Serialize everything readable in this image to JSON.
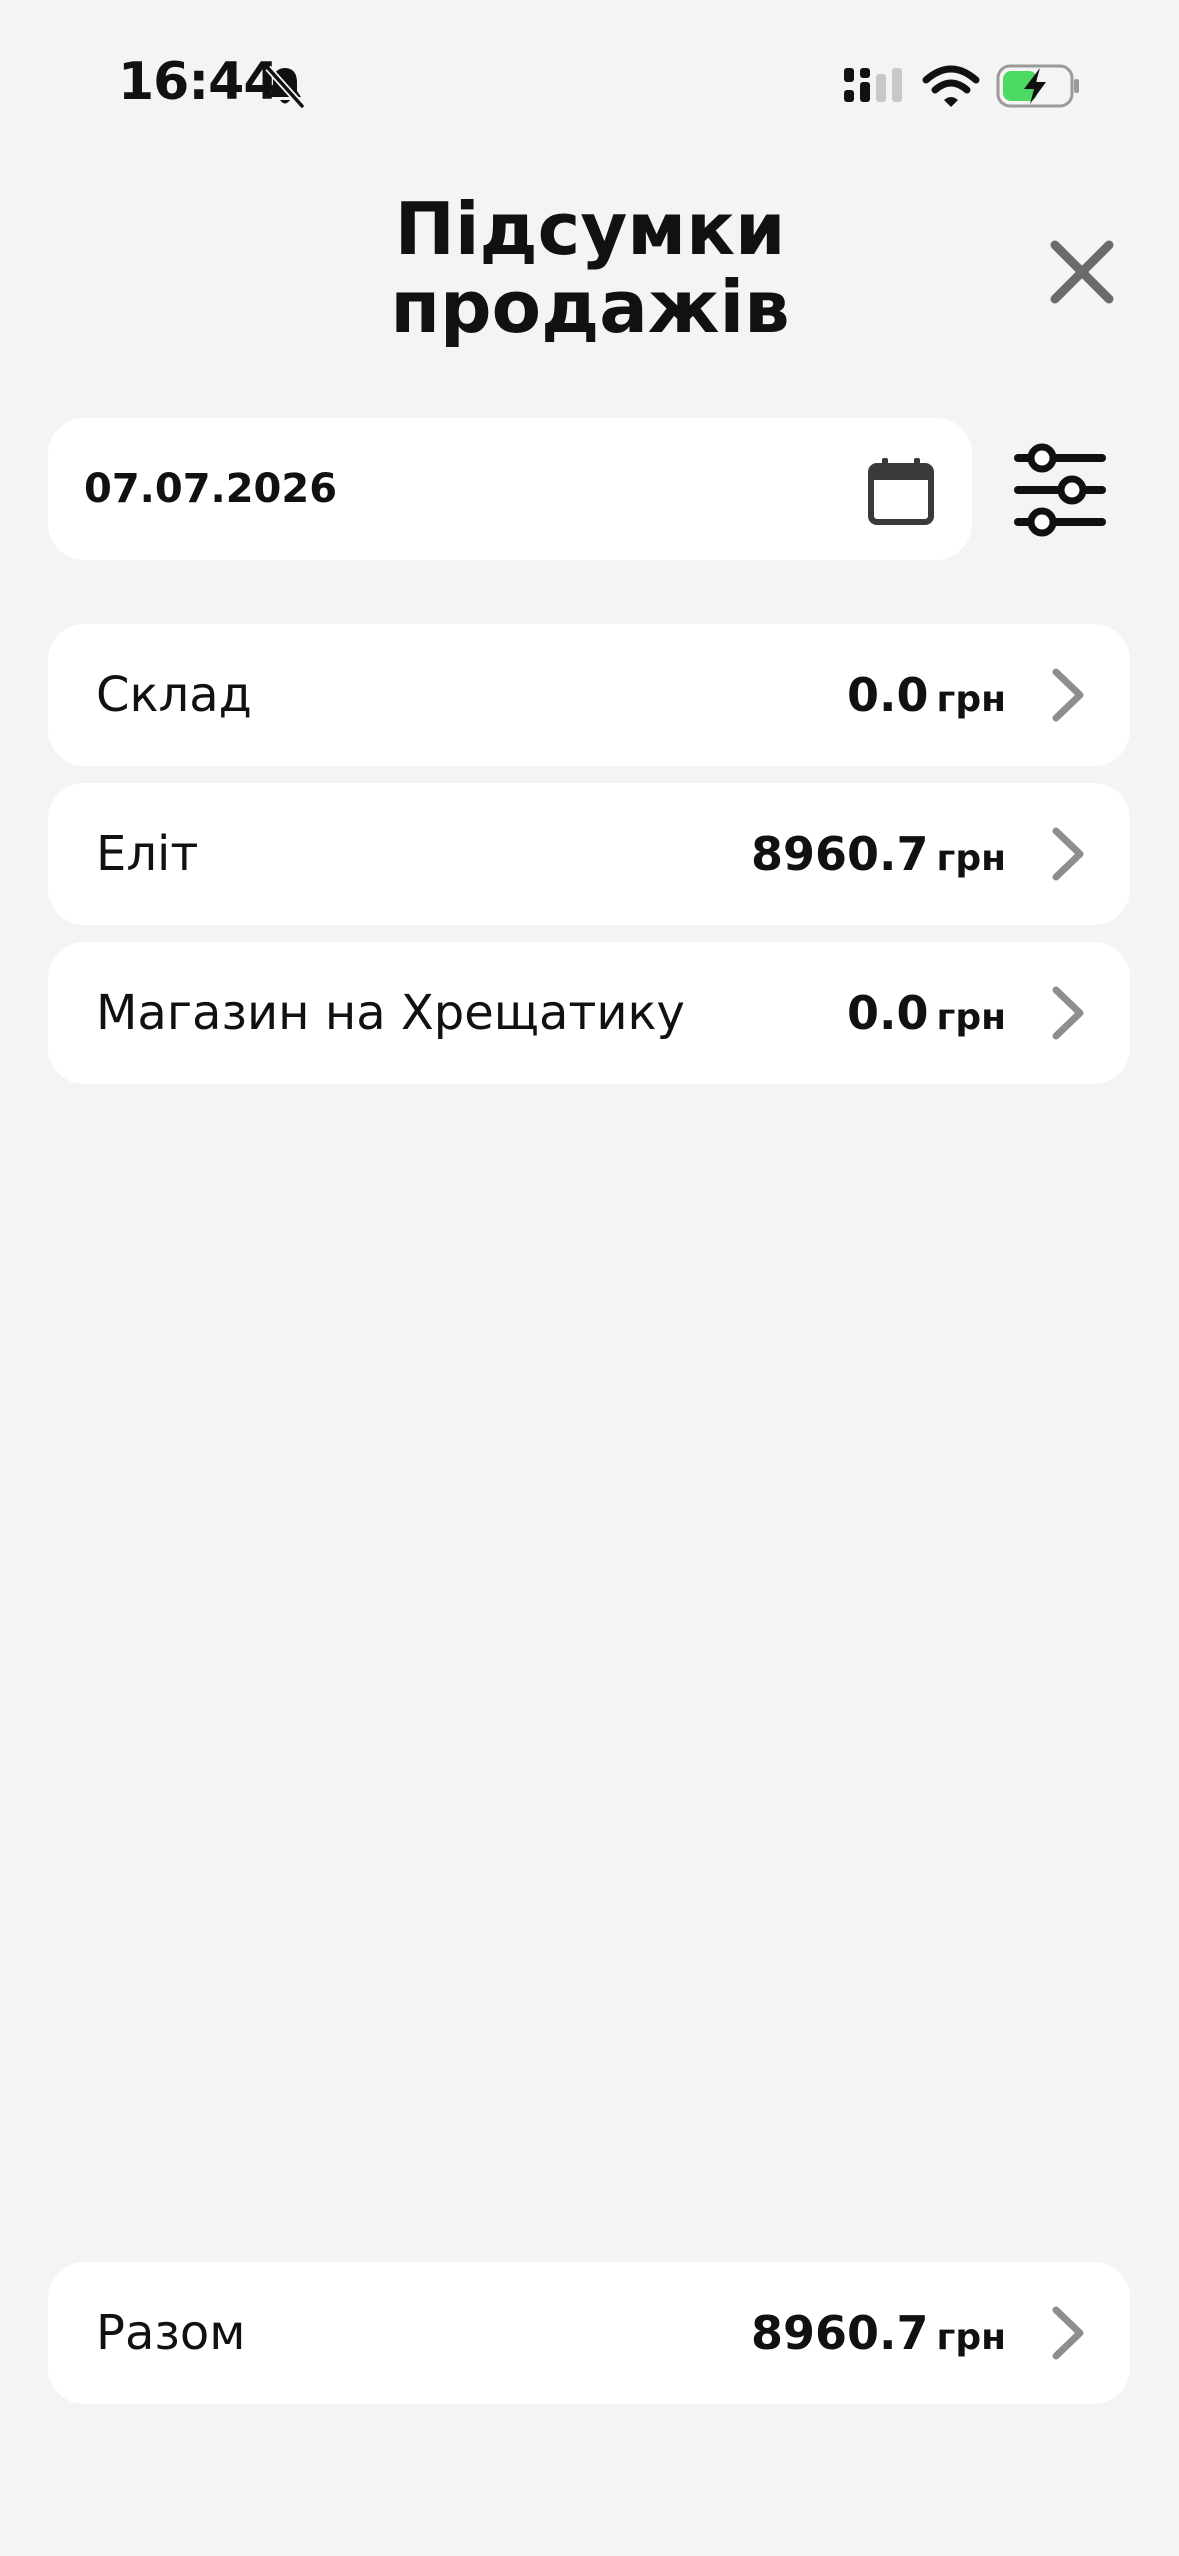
{
  "status_bar": {
    "time": "16:44",
    "icons": [
      "bell-muted-icon",
      "cellular-icon",
      "wifi-icon",
      "battery-charging-icon"
    ],
    "battery_color": "#4cd964"
  },
  "header": {
    "title_line1": "Підсумки",
    "title_line2": "продажів",
    "close_icon": "close-icon"
  },
  "date_filter": {
    "value": "07.07.2026",
    "icon": "calendar-icon",
    "filter_icon": "sliders-icon"
  },
  "stores": [
    {
      "name": "Склад",
      "amount": "0.0",
      "unit": "грн"
    },
    {
      "name": "Еліт",
      "amount": "8960.7",
      "unit": "грн"
    },
    {
      "name": "Магазин на Хрещатику",
      "amount": "0.0",
      "unit": "грн"
    }
  ],
  "total": {
    "label": "Разом",
    "amount": "8960.7",
    "unit": "грн"
  },
  "colors": {
    "background": "#f4f4f4",
    "card": "#ffffff",
    "text": "#111111",
    "chevron": "#8e8e8e",
    "close": "#6b6b6b"
  }
}
